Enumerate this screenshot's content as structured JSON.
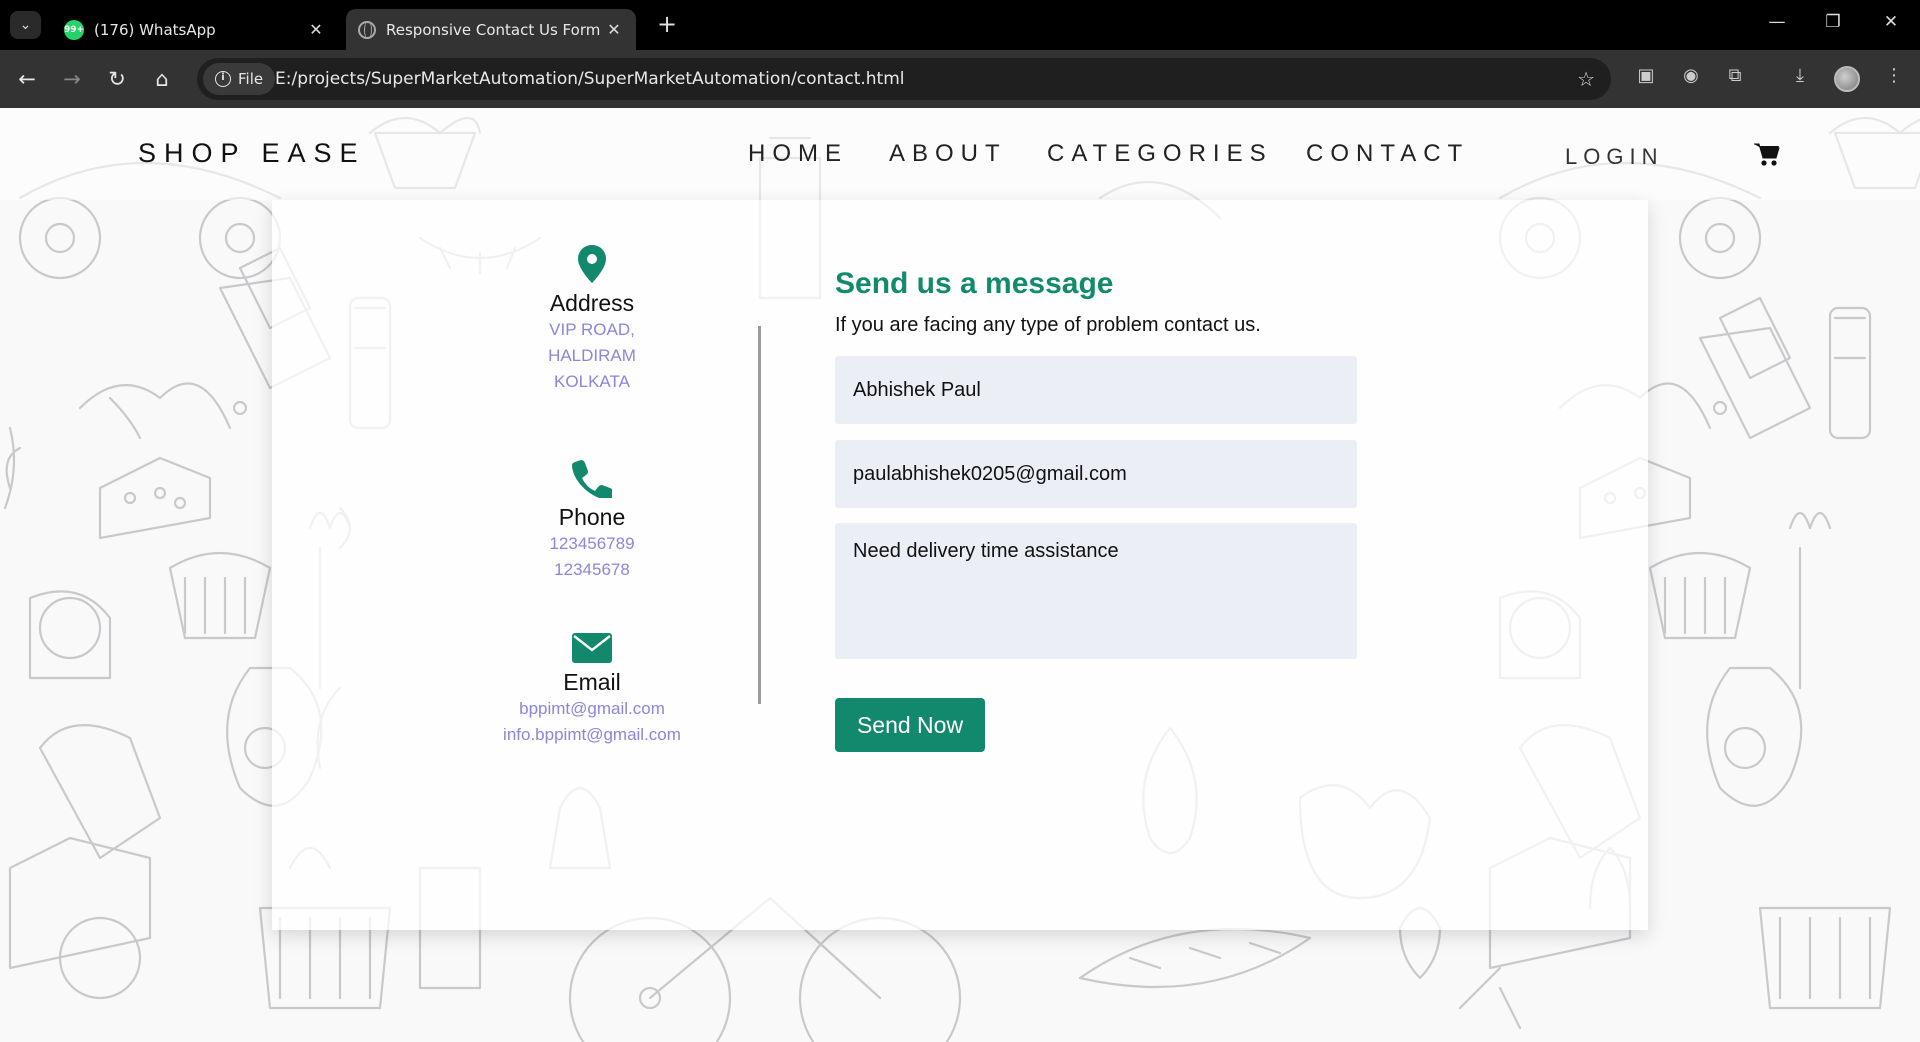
{
  "browser": {
    "tabs": [
      {
        "title": "(176) WhatsApp",
        "badge": "99+",
        "icon": "whatsapp-icon",
        "active": false
      },
      {
        "title": "Responsive Contact Us Form | C",
        "icon": "globe-icon",
        "active": true
      }
    ],
    "site_chip_label": "File",
    "url": "E:/projects/SuperMarketAutomation/SuperMarketAutomation/contact.html"
  },
  "header": {
    "logo": "SHOP EASE",
    "nav": [
      "HOME",
      "ABOUT",
      "CATEGORIES",
      "CONTACT"
    ],
    "login": "LOGIN",
    "cart_icon": "cart-icon"
  },
  "contact_info": {
    "address": {
      "heading": "Address",
      "lines": [
        "VIP ROAD,",
        "HALDIRAM",
        "KOLKATA"
      ],
      "icon": "map-pin-icon"
    },
    "phone": {
      "heading": "Phone",
      "lines": [
        "123456789",
        "12345678"
      ],
      "icon": "phone-icon"
    },
    "email": {
      "heading": "Email",
      "lines": [
        "bppimt@gmail.com",
        "info.bppimt@gmail.com"
      ],
      "icon": "envelope-icon"
    }
  },
  "form": {
    "title": "Send us a message",
    "subtitle": "If you are facing any type of problem contact us.",
    "name_value": "Abhishek Paul",
    "email_value": "paulabhishek0205@gmail.com",
    "message_value": "Need delivery time assistance",
    "submit_label": "Send Now"
  },
  "colors": {
    "accent": "#12896d",
    "info_text": "#8b86d8",
    "field_bg": "#eceef6"
  }
}
